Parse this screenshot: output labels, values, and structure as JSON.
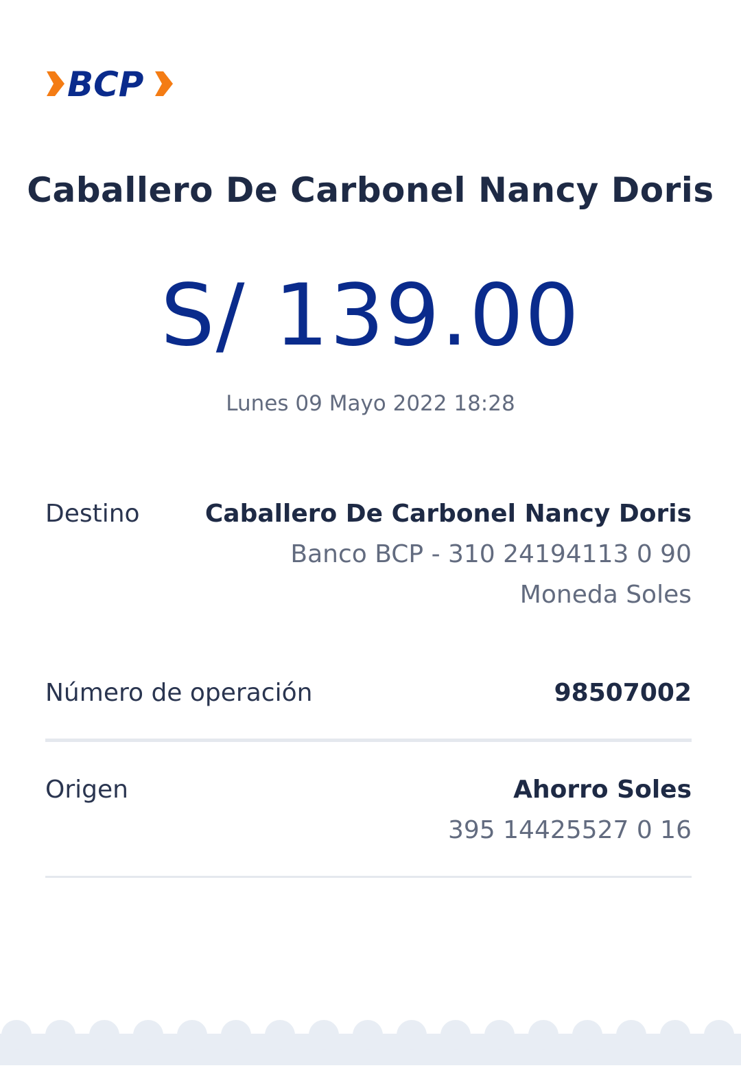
{
  "brand": {
    "logo_text": "BCP",
    "primary_color": "#0a2b8c",
    "accent_color": "#f47c14"
  },
  "receipt": {
    "recipient_title": "Caballero De Carbonel Nancy Doris",
    "amount": "S/ 139.00",
    "datetime": "Lunes 09 Mayo 2022 18:28"
  },
  "details": {
    "destino": {
      "label": "Destino",
      "name": "Caballero De Carbonel Nancy Doris",
      "account": "Banco BCP - 310 24194113 0 90",
      "currency": "Moneda Soles"
    },
    "operacion": {
      "label": "Número de operación",
      "value": "98507002"
    },
    "origen": {
      "label": "Origen",
      "account_type": "Ahorro Soles",
      "account_number": "395 14425527 0 16"
    }
  },
  "icons": {
    "logo": "bcp-logo",
    "footer": "scalloped-receipt-edge"
  }
}
